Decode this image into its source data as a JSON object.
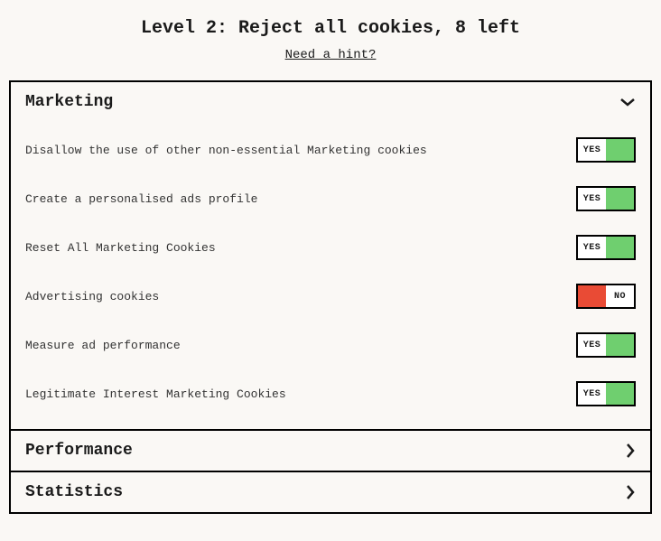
{
  "title": "Level 2: Reject all cookies, 8 left",
  "hint_text": "Need a hint?",
  "toggle": {
    "yes": "YES",
    "no": "NO"
  },
  "sections": {
    "marketing": {
      "title": "Marketing",
      "expanded": true,
      "items": [
        {
          "label": "Disallow the use of other non-essential Marketing cookies",
          "state": "yes"
        },
        {
          "label": "Create a personalised ads profile",
          "state": "yes"
        },
        {
          "label": "Reset All Marketing Cookies",
          "state": "yes"
        },
        {
          "label": "Advertising cookies",
          "state": "no"
        },
        {
          "label": "Measure ad performance",
          "state": "yes"
        },
        {
          "label": "Legitimate Interest Marketing Cookies",
          "state": "yes"
        }
      ]
    },
    "performance": {
      "title": "Performance",
      "expanded": false
    },
    "statistics": {
      "title": "Statistics",
      "expanded": false
    }
  }
}
